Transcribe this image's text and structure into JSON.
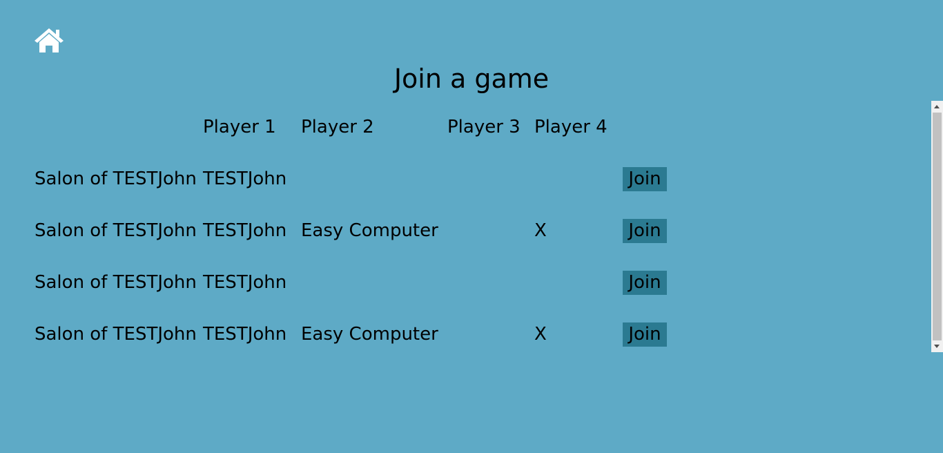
{
  "header": {
    "home_icon": "home-icon",
    "title": "Join a game"
  },
  "table": {
    "columns": [
      "Player 1",
      "Player 2",
      "Player 3",
      "Player 4"
    ],
    "rows": [
      {
        "name": "Salon of TESTJohn",
        "player1": "TESTJohn",
        "player2": "",
        "player3": "",
        "player4": "",
        "action": "Join"
      },
      {
        "name": "Salon of TESTJohn",
        "player1": "TESTJohn",
        "player2": "Easy Computer",
        "player3": "",
        "player4": "X",
        "action": "Join"
      },
      {
        "name": "Salon of TESTJohn",
        "player1": "TESTJohn",
        "player2": "",
        "player3": "",
        "player4": "",
        "action": "Join"
      },
      {
        "name": "Salon of TESTJohn",
        "player1": "TESTJohn",
        "player2": "Easy Computer",
        "player3": "",
        "player4": "X",
        "action": "Join"
      }
    ]
  },
  "colors": {
    "background": "#5eaac6",
    "join_button": "#2b7a91",
    "home_icon": "#ffffff"
  }
}
